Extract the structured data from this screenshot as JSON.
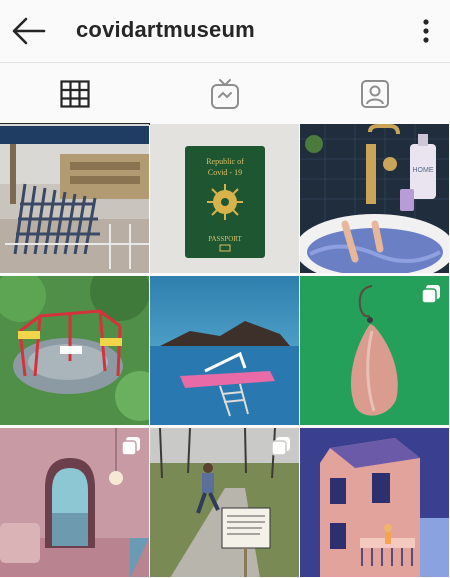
{
  "header": {
    "back_icon": "arrow-left-icon",
    "username": "covidartmuseum",
    "more_icon": "vertical-dots-icon"
  },
  "tabs": [
    {
      "name": "grid",
      "icon": "grid-icon",
      "active": true
    },
    {
      "name": "igtv",
      "icon": "tv-icon",
      "active": false
    },
    {
      "name": "tagged",
      "icon": "tagged-person-icon",
      "active": false
    }
  ],
  "posts": [
    {
      "id": "post-1",
      "subject": "stacked-chairs",
      "multi": false
    },
    {
      "id": "post-2",
      "subject": "passport",
      "multi": false,
      "text": {
        "line1": "Republic of",
        "line2": "Covid - 19",
        "bottom": "PASSPORT"
      }
    },
    {
      "id": "post-3",
      "subject": "bathtub",
      "multi": false,
      "text": {
        "bottle": "HOME"
      }
    },
    {
      "id": "post-4",
      "subject": "playground-carousel",
      "multi": false
    },
    {
      "id": "post-5",
      "subject": "island-pool",
      "multi": false
    },
    {
      "id": "post-6",
      "subject": "garlic-earring",
      "multi": true
    },
    {
      "id": "post-7",
      "subject": "arch-room",
      "multi": true
    },
    {
      "id": "post-8",
      "subject": "man-running-sign",
      "multi": true
    },
    {
      "id": "post-9",
      "subject": "building-balcony",
      "multi": false
    }
  ],
  "colors": {
    "active": "#262626",
    "inactive": "#8e8e8e",
    "divider": "#e3e3e3"
  }
}
